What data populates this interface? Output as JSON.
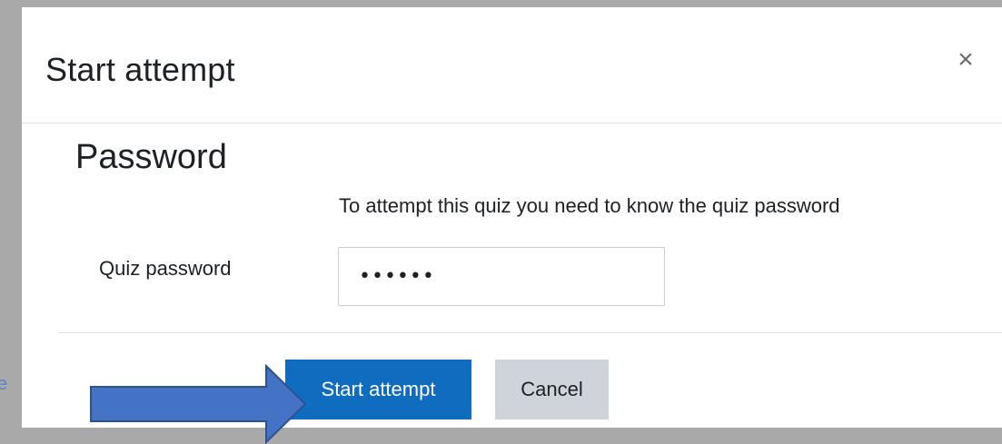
{
  "background_page": {
    "peek_text": "e"
  },
  "dialog": {
    "title": "Start attempt",
    "close_symbol": "×",
    "section_title": "Password",
    "help_text": "To attempt this quiz you need to know the quiz password",
    "password_field": {
      "label": "Quiz password",
      "value": "••••••"
    },
    "buttons": {
      "start_label": "Start attempt",
      "cancel_label": "Cancel"
    }
  },
  "annotation": {
    "shape": "arrow-right",
    "fill_color": "#4472c4",
    "stroke_color": "#2f528f"
  },
  "colors": {
    "primary_button": "#0f6cbf",
    "secondary_button": "#ced4da",
    "backdrop": "#a9a9a9"
  }
}
